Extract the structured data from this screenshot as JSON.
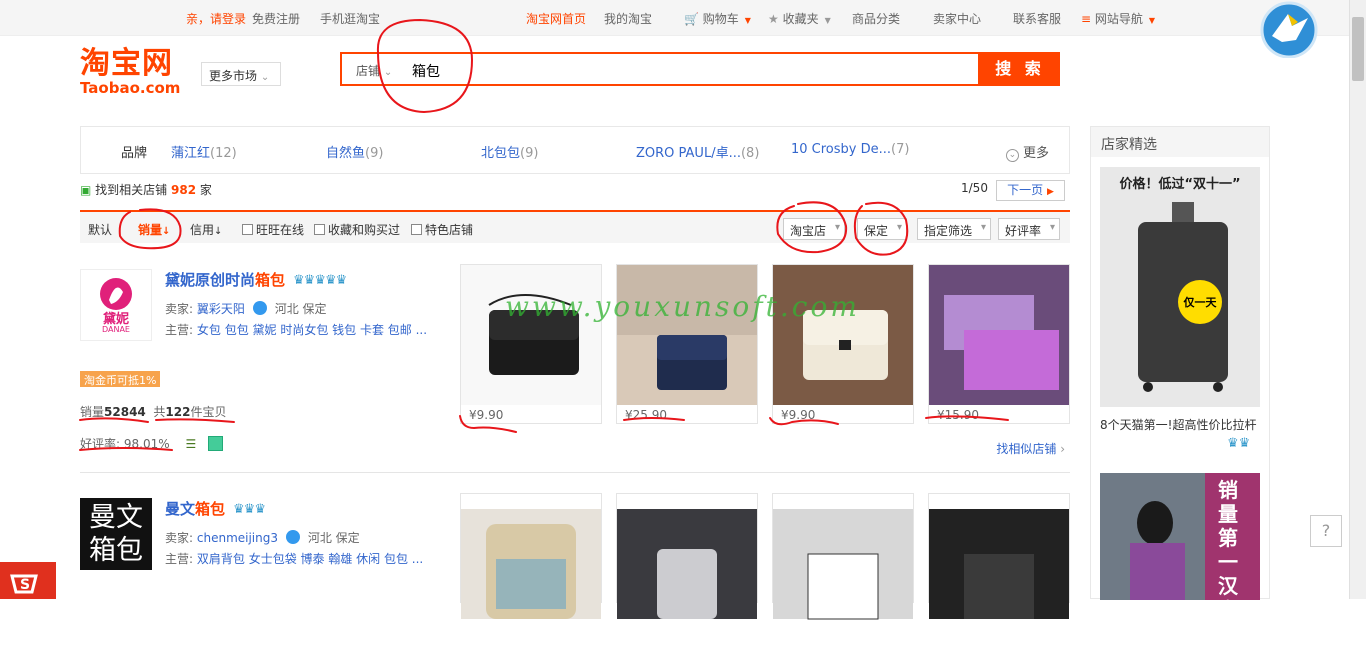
{
  "topbar": {
    "login": "亲，请登录",
    "register": "免费注册",
    "mobile": "手机逛淘宝",
    "home": "淘宝网首页",
    "my": "我的淘宝",
    "cart": "购物车",
    "fav": "收藏夹",
    "category": "商品分类",
    "seller": "卖家中心",
    "service": "联系客服",
    "nav": "网站导航"
  },
  "logo": {
    "cn": "淘宝网",
    "en": "Taobao.com"
  },
  "market": "更多市场",
  "search": {
    "type": "店铺",
    "value": "箱包",
    "button": "搜 索"
  },
  "brands": {
    "label": "品牌",
    "items": [
      {
        "name": "蒲江红",
        "count": "(12)"
      },
      {
        "name": "自然鱼",
        "count": "(9)"
      },
      {
        "name": "北包包",
        "count": "(9)"
      },
      {
        "name": "ZORO PAUL/卓...",
        "count": "(8)"
      },
      {
        "name": "10 Crosby De...",
        "count": "(7)"
      }
    ],
    "more": "更多"
  },
  "found": {
    "prefix": "找到相关店铺",
    "count": "982",
    "suffix": "家"
  },
  "pager": {
    "page": "1/50",
    "next": "下一页"
  },
  "sort": {
    "default": "默认",
    "sales": "销量",
    "credit": "信用",
    "wangwang": "旺旺在线",
    "favbought": "收藏和购买过",
    "special": "特色店铺",
    "taobao_shop": "淘宝店",
    "guarantee": "保定",
    "filter": "指定筛选",
    "rating": "好评率"
  },
  "shops": [
    {
      "logo_text": "黛妮",
      "logo_sub": "DANAE",
      "title_pre": "黛妮原创时尚",
      "title_hl": "箱包",
      "seller_label": "卖家:",
      "seller": "翼彩天阳",
      "location": "河北 保定",
      "main_label": "主营:",
      "main": "女包 包包 黛妮 时尚女包 钱包 卡套 包邮 ...",
      "tag": "淘金币可抵1%",
      "sales_label": "销量",
      "sales": "52844",
      "total_pre": "共",
      "total": "122",
      "total_suf": "件宝贝",
      "rating": "好评率: 98.01%",
      "similar": "找相似店铺",
      "products": [
        {
          "price": "¥9.90"
        },
        {
          "price": "¥25.90"
        },
        {
          "price": "¥9.90"
        },
        {
          "price": "¥15.90"
        }
      ]
    },
    {
      "logo_text": "曼文箱包",
      "title_pre": "曼文",
      "title_hl": "箱包",
      "seller_label": "卖家:",
      "seller": "chenmeijing3",
      "location": "河北 保定",
      "main_label": "主营:",
      "main": "双肩背包 女士包袋 博泰 翰雄 休闲 包包 ..."
    }
  ],
  "sidebar": {
    "title": "店家精选",
    "ad1_badge": "价格！低过“双十一”",
    "ad1_circle": "仅一天",
    "ad1_caption": "8个天猫第一!超高性价比拉杆",
    "ad2_text": "销量第一汉客拉"
  },
  "watermark": "www.youxunsoft.com",
  "help": "?",
  "colors": {
    "accent": "#ff4400",
    "link": "#3366cc",
    "annotation": "#e8161b"
  }
}
